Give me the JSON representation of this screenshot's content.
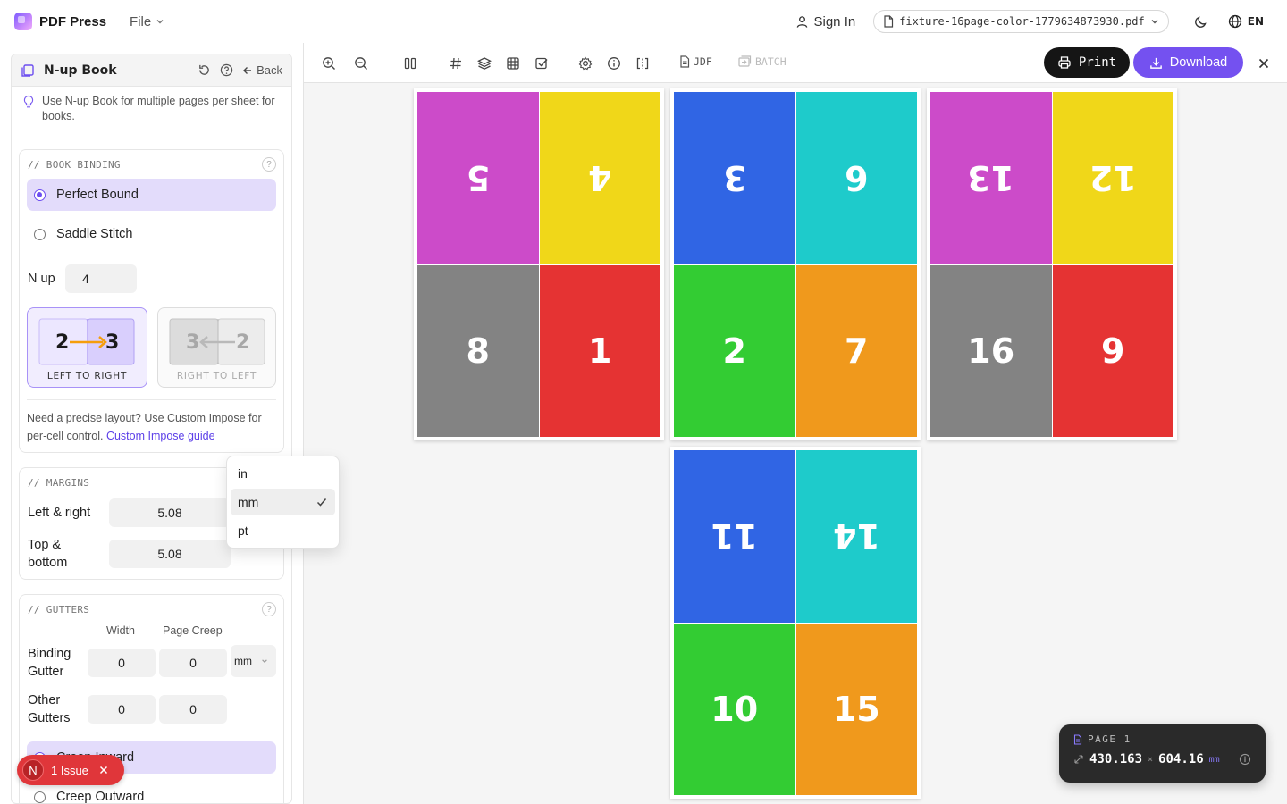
{
  "app": {
    "name": "PDF Press",
    "file_menu": "File",
    "sign_in": "Sign In",
    "filename": "fixture-16page-color-1779634873930.pdf",
    "language": "EN"
  },
  "toolbar": {
    "jdf": "JDF",
    "batch": "BATCH",
    "print": "Print",
    "download": "Download"
  },
  "panel": {
    "title": "N-up Book",
    "back": "Back",
    "tip": "Use N-up Book for multiple pages per sheet for books.",
    "binding": {
      "label": "// BOOK BINDING",
      "options": [
        "Perfect Bound",
        "Saddle Stitch"
      ],
      "selected": "Perfect Bound",
      "nup_label": "N up",
      "nup_value": "4",
      "ltr_caption": "LEFT TO RIGHT",
      "rtl_caption": "RIGHT TO LEFT",
      "ltr_a": "2",
      "ltr_b": "3",
      "rtl_a": "3",
      "rtl_b": "2",
      "selected_direction": "LEFT TO RIGHT",
      "note": "Need a precise layout? Use Custom Impose for per-cell control.",
      "note_link": "Custom Impose guide"
    },
    "margins": {
      "label": "// MARGINS",
      "left_right_label": "Left & right",
      "left_right_value": "5.08",
      "top_bottom_label_1": "Top &",
      "top_bottom_label_2": "bottom",
      "top_bottom_value": "5.08"
    },
    "unit_dropdown": {
      "options": [
        "in",
        "mm",
        "pt"
      ],
      "selected": "mm"
    },
    "gutters": {
      "label": "// GUTTERS",
      "col_width": "Width",
      "col_creep": "Page Creep",
      "binding_label_1": "Binding",
      "binding_label_2": "Gutter",
      "binding_width": "0",
      "binding_creep": "0",
      "unit": "mm",
      "other_label_1": "Other",
      "other_label_2": "Gutters",
      "other_width": "0",
      "other_creep": "0",
      "creep_options": [
        "Creep Inward",
        "Creep Outward"
      ],
      "creep_selected": "Creep Inward"
    }
  },
  "issues": {
    "badge": "N",
    "text": "1 Issue"
  },
  "sheets": [
    {
      "cells": [
        {
          "n": "5",
          "color": "#cc4bc9",
          "flip": true
        },
        {
          "n": "4",
          "color": "#f0d719",
          "flip": true
        },
        {
          "n": "8",
          "color": "#838383",
          "flip": false
        },
        {
          "n": "1",
          "color": "#e53333",
          "flip": false
        }
      ]
    },
    {
      "cells": [
        {
          "n": "3",
          "color": "#3065e4",
          "flip": true
        },
        {
          "n": "6",
          "color": "#1ecbcb",
          "flip": true
        },
        {
          "n": "2",
          "color": "#33cc33",
          "flip": false
        },
        {
          "n": "7",
          "color": "#f0991c",
          "flip": false
        }
      ]
    },
    {
      "cells": [
        {
          "n": "13",
          "color": "#cc4bc9",
          "flip": true
        },
        {
          "n": "12",
          "color": "#f0d719",
          "flip": true
        },
        {
          "n": "16",
          "color": "#838383",
          "flip": false
        },
        {
          "n": "9",
          "color": "#e53333",
          "flip": false
        }
      ]
    },
    {
      "cells": [
        {
          "n": "11",
          "color": "#3065e4",
          "flip": true
        },
        {
          "n": "14",
          "color": "#1ecbcb",
          "flip": true
        },
        {
          "n": "10",
          "color": "#33cc33",
          "flip": false
        },
        {
          "n": "15",
          "color": "#f0991c",
          "flip": false
        }
      ]
    }
  ],
  "page_info": {
    "label": "PAGE 1",
    "width": "430.163",
    "height": "604.16",
    "unit": "mm"
  },
  "colors": {
    "accent": "#7451f0",
    "selected_bg": "#e3dcfb",
    "issue_red": "#e0363a"
  }
}
